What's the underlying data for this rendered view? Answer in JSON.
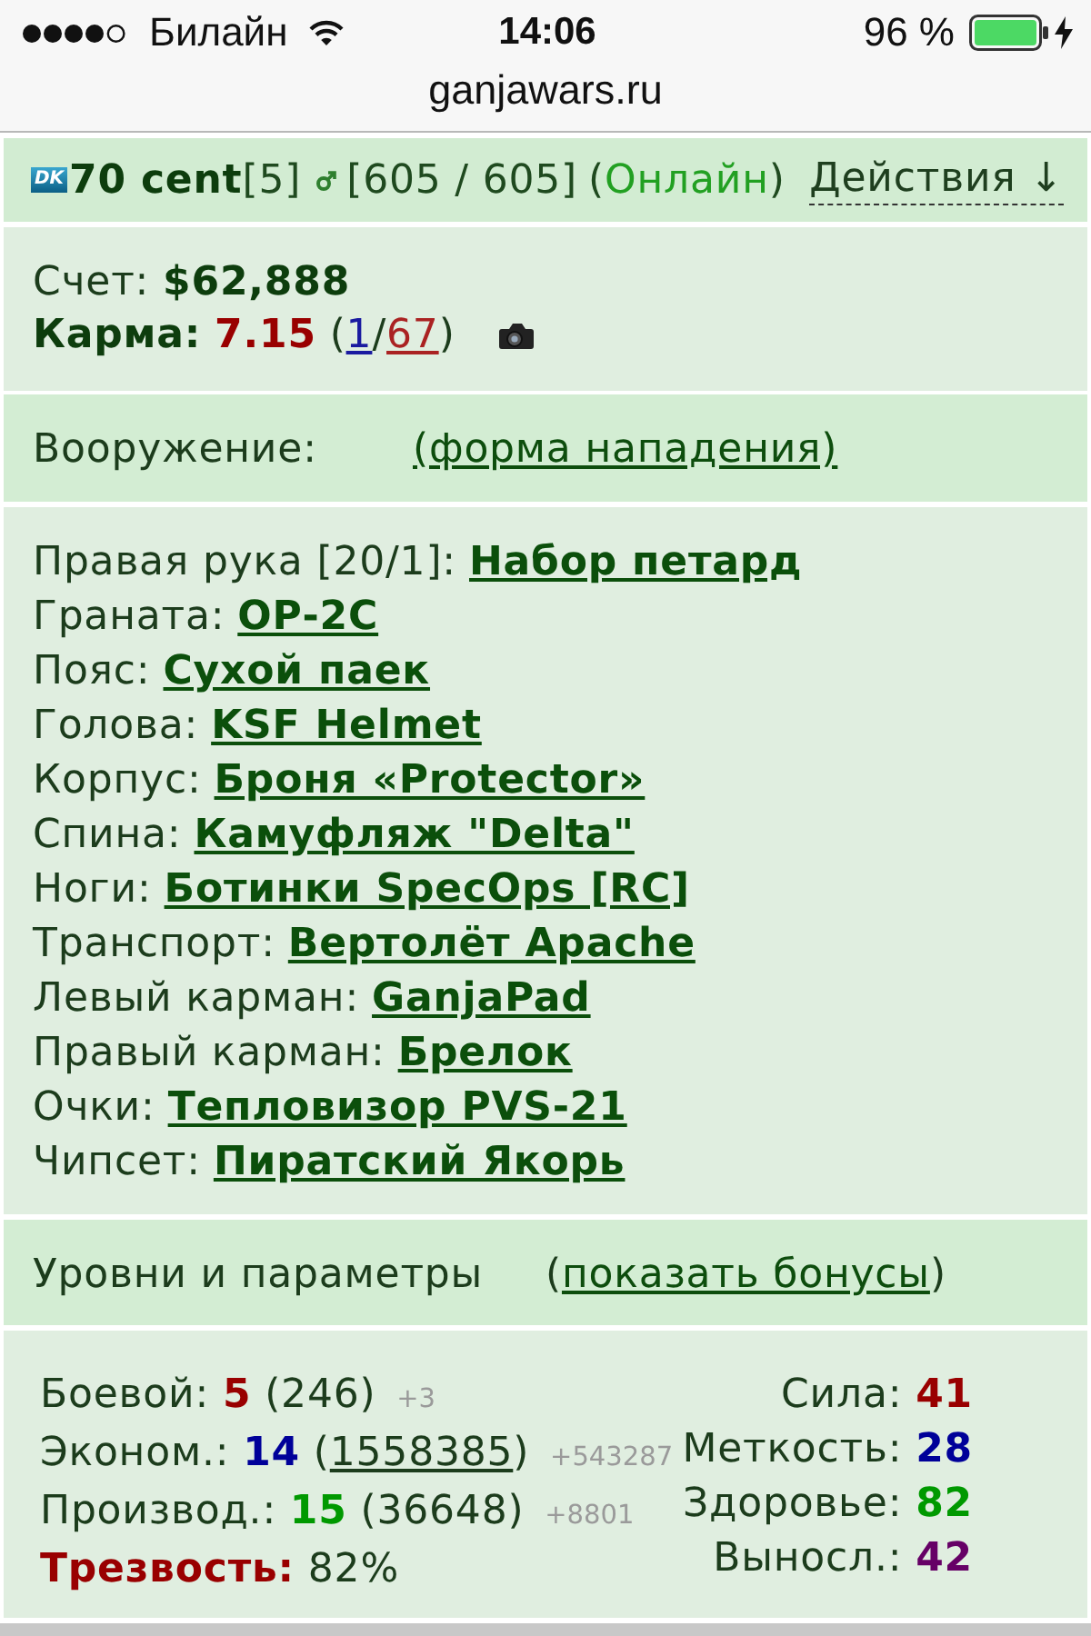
{
  "status_bar": {
    "carrier": "Билайн",
    "time": "14:06",
    "battery": "96 %"
  },
  "address_bar": {
    "url": "ganjawars.ru"
  },
  "player": {
    "clan_badge": "DK",
    "name": "70 cent",
    "rank": "[5]",
    "hp": "[605 / 605]",
    "status": {
      "open": "(",
      "text": "Онлайн",
      "close": ")"
    },
    "actions": "Действия ↓"
  },
  "account": {
    "balance_label": "Счет:",
    "balance": "$62,888",
    "karma": {
      "label": "Карма:",
      "value": "7.15",
      "open": "(",
      "positive": "1",
      "separator": "/",
      "negative": "67",
      "close": ")"
    }
  },
  "equipment": {
    "title": "Вооружение:",
    "link": "(форма нападения)",
    "slots": [
      {
        "label": "Правая рука [20/1]:",
        "item": "Набор петард"
      },
      {
        "label": "Граната:",
        "item": "ОР-2С"
      },
      {
        "label": "Пояс:",
        "item": "Сухой паек"
      },
      {
        "label": "Голова:",
        "item": "KSF Helmet"
      },
      {
        "label": "Корпус:",
        "item": "Броня «Protector»"
      },
      {
        "label": "Спина:",
        "item": "Камуфляж \"Delta\""
      },
      {
        "label": "Ноги:",
        "item": "Ботинки SpecOps [RC]"
      },
      {
        "label": "Транспорт:",
        "item": "Вертолёт Apache"
      },
      {
        "label": "Левый карман:",
        "item": "GanjaPad"
      },
      {
        "label": "Правый карман:",
        "item": "Брелок"
      },
      {
        "label": "Очки:",
        "item": "Тепловизор PVS-21"
      },
      {
        "label": "Чипсет:",
        "item": "Пиратский Якорь"
      }
    ]
  },
  "levels": {
    "title": "Уровни и параметры",
    "toggle": {
      "open": "(",
      "link": "показать бонусы",
      "close": ")"
    },
    "skills": [
      {
        "kind": "skill",
        "label": "Боевой:",
        "value": "5",
        "color": "#990000",
        "exp_open": "(",
        "experience": "246",
        "exp_close": ")",
        "linked": false,
        "bonus": "+3"
      },
      {
        "kind": "skill",
        "label": "Эконом.:",
        "value": "14",
        "color": "#000099",
        "exp_open": "(",
        "experience": "1558385",
        "exp_close": ")",
        "linked": true,
        "bonus": "+543287"
      },
      {
        "kind": "skill",
        "label": "Производ.:",
        "value": "15",
        "color": "#009900",
        "exp_open": "(",
        "experience": "36648",
        "exp_close": ")",
        "linked": false,
        "bonus": "+8801"
      },
      {
        "kind": "sobriety",
        "label": "Трезвость:",
        "value": "82%",
        "color": "#990000"
      }
    ],
    "attributes": [
      {
        "label": "Сила:",
        "value": "41",
        "color": "#990000"
      },
      {
        "label": "Меткость:",
        "value": "28",
        "color": "#000099"
      },
      {
        "label": "Здоровье:",
        "value": "82",
        "color": "#009900"
      },
      {
        "label": "Выносл.:",
        "value": "42",
        "color": "#660066"
      }
    ]
  }
}
